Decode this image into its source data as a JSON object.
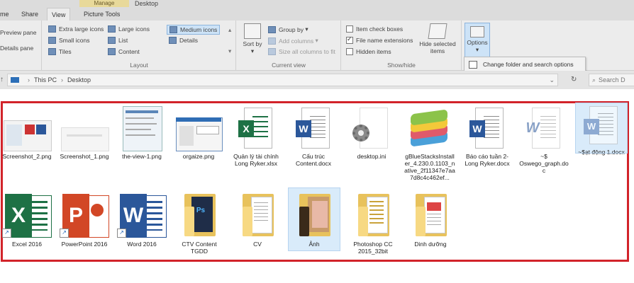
{
  "window": {
    "title": "Desktop",
    "context_tab_header": "Manage"
  },
  "tabs": [
    {
      "label": "me",
      "active": false
    },
    {
      "label": "Share",
      "active": false
    },
    {
      "label": "View",
      "active": true
    },
    {
      "label": "Picture Tools",
      "active": false
    }
  ],
  "ribbon": {
    "panes": {
      "preview": "Preview pane",
      "details": "Details pane"
    },
    "layout": {
      "label": "Layout",
      "options": [
        "Extra large icons",
        "Large icons",
        "Medium icons",
        "Small icons",
        "List",
        "Details",
        "Tiles",
        "Content"
      ],
      "selected": "Medium icons"
    },
    "current_view": {
      "label": "Current view",
      "sort_by": "Sort by",
      "group_by": "Group by",
      "add_columns": "Add columns",
      "size_all": "Size all columns to fit"
    },
    "show_hide": {
      "label": "Show/hide",
      "item_check_boxes": {
        "label": "Item check boxes",
        "checked": false
      },
      "file_name_extensions": {
        "label": "File name extensions",
        "checked": true
      },
      "hidden_items": {
        "label": "Hidden items",
        "checked": false
      },
      "hide_selected": "Hide selected items"
    },
    "options": {
      "label": "Options",
      "menu_item": "Change folder and search options"
    }
  },
  "address": {
    "crumbs": [
      "This PC",
      "Desktop"
    ],
    "search_placeholder": "Search D"
  },
  "files_row1": [
    {
      "name": "Screenshot_2.png",
      "kind": "image"
    },
    {
      "name": "Screenshot_1.png",
      "kind": "image"
    },
    {
      "name": "the-view-1.png",
      "kind": "image"
    },
    {
      "name": "orgaize.png",
      "kind": "image"
    },
    {
      "name": "Quản lý tài chính Long Ryker.xlsx",
      "kind": "excel"
    },
    {
      "name": "Cấu trúc Content.docx",
      "kind": "word"
    },
    {
      "name": "desktop.ini",
      "kind": "settings"
    },
    {
      "name": "gBlueStacksInstaller_4.230.0.1103_native_2f11347e7aa7d8c4c462ef...",
      "kind": "bluestacks"
    },
    {
      "name": "Báo cáo tuần 2-Long Ryker.docx",
      "kind": "word"
    },
    {
      "name": "~$ Oswego_graph.doc",
      "kind": "word-faded"
    },
    {
      "name": "~$ạt động 1.docx",
      "kind": "word-faded"
    }
  ],
  "files_row2": [
    {
      "name": "Excel 2016",
      "kind": "excel-app"
    },
    {
      "name": "PowerPoint 2016",
      "kind": "ppt-app"
    },
    {
      "name": "Word 2016",
      "kind": "word-app"
    },
    {
      "name": "CTV Content TGDD",
      "kind": "folder"
    },
    {
      "name": "CV",
      "kind": "folder"
    },
    {
      "name": "Ảnh",
      "kind": "folder-photo"
    },
    {
      "name": "Photoshop CC 2015_32bit",
      "kind": "folder"
    },
    {
      "name": "Dinh dưỡng",
      "kind": "folder"
    }
  ],
  "colors": {
    "highlight_border": "#d2232a",
    "excel": "#1e7145",
    "word": "#2b579a",
    "powerpoint": "#d24726",
    "folder": "#f7d983"
  }
}
